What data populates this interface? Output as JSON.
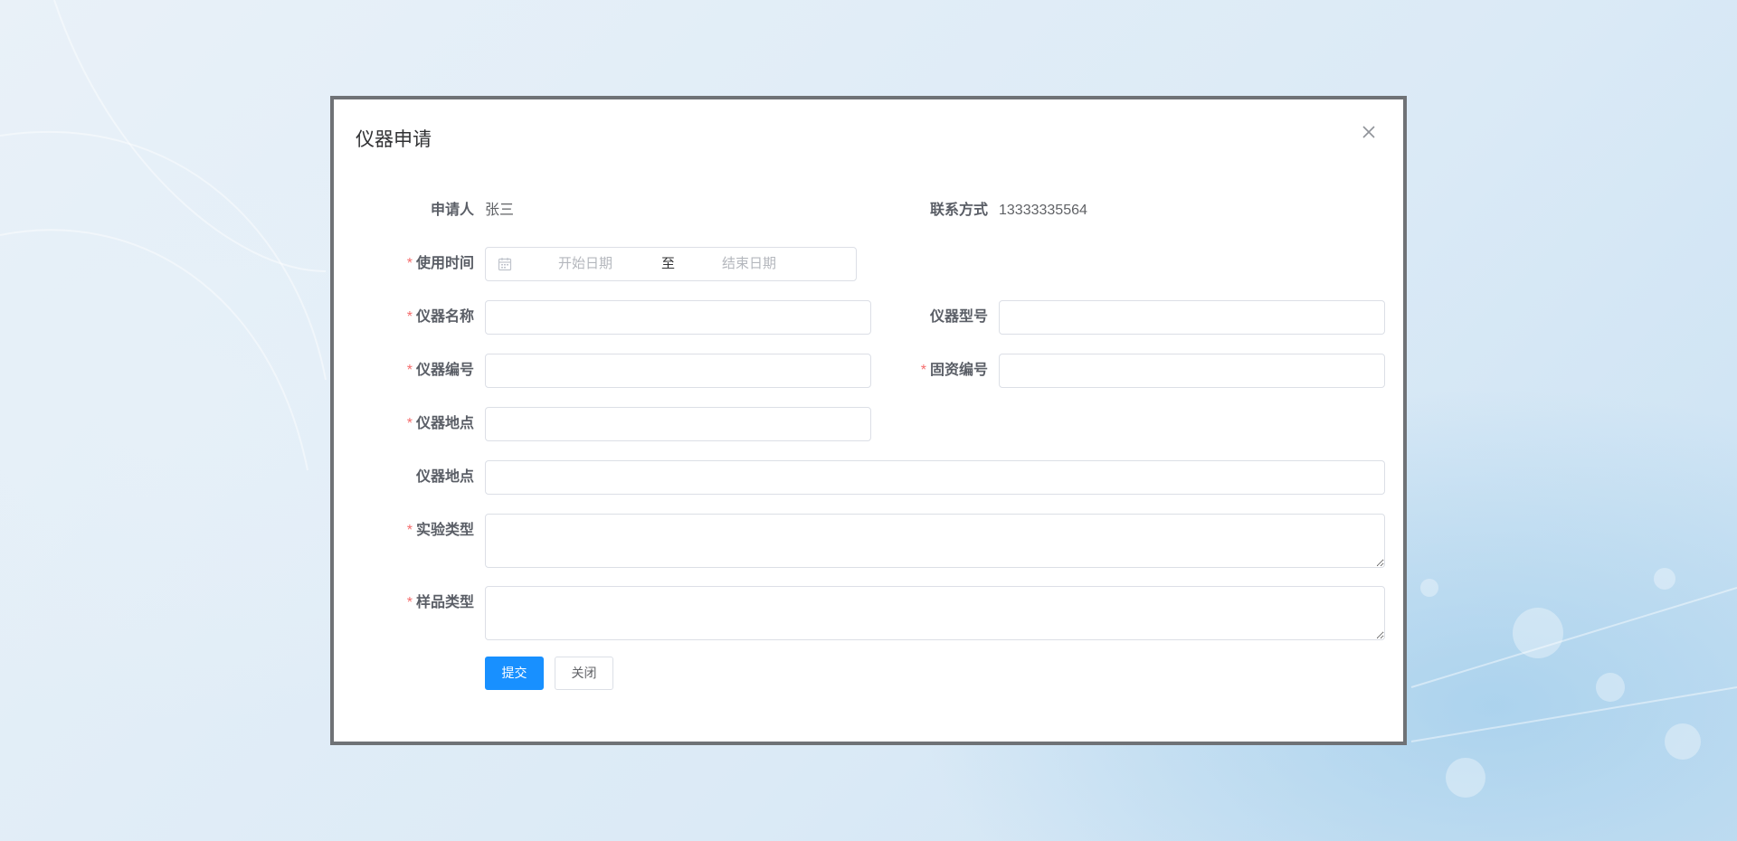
{
  "dialog": {
    "title": "仪器申请",
    "close_icon": "close-icon"
  },
  "form": {
    "applicant": {
      "label": "申请人",
      "value": "张三"
    },
    "contact": {
      "label": "联系方式",
      "value": "13333335564"
    },
    "usage_time": {
      "label": "使用时间",
      "required": true,
      "start_placeholder": "开始日期",
      "separator": "至",
      "end_placeholder": "结束日期",
      "icon": "calendar-icon"
    },
    "instrument_name": {
      "label": "仪器名称",
      "required": true,
      "value": ""
    },
    "instrument_model": {
      "label": "仪器型号",
      "required": false,
      "value": ""
    },
    "instrument_number": {
      "label": "仪器编号",
      "required": true,
      "value": ""
    },
    "asset_number": {
      "label": "固资编号",
      "required": true,
      "value": ""
    },
    "instrument_location": {
      "label": "仪器地点",
      "required": true,
      "value": ""
    },
    "instrument_location_2": {
      "label": "仪器地点",
      "required": false,
      "value": ""
    },
    "experiment_type": {
      "label": "实验类型",
      "required": true,
      "value": ""
    },
    "sample_type": {
      "label": "样品类型",
      "required": true,
      "value": ""
    }
  },
  "buttons": {
    "submit": "提交",
    "close": "关闭"
  },
  "colors": {
    "primary": "#1890ff",
    "required_star": "#f56c6c",
    "dialog_border": "#6f7276"
  }
}
